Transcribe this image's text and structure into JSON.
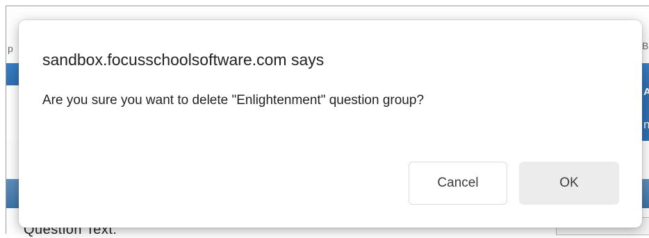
{
  "dialog": {
    "title": "sandbox.focusschoolsoftware.com says",
    "message": "Are you sure you want to delete \"Enlightenment\" question group?",
    "cancel_label": "Cancel",
    "ok_label": "OK"
  },
  "background": {
    "question_label": "Question Text:",
    "left_glyph": "p",
    "right_glyph": "B",
    "right_letter_a": "A",
    "right_letter_n": "n"
  }
}
